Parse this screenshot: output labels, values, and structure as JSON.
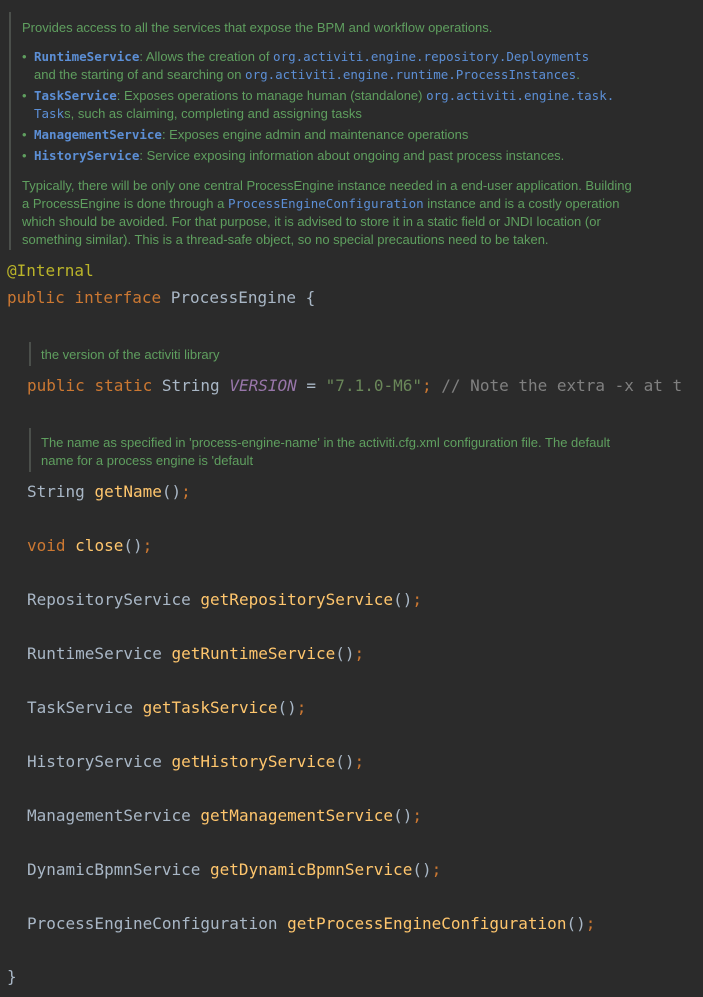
{
  "doc1": {
    "intro": "Provides access to all the services that expose the BPM and workflow operations.",
    "b1_name": "RuntimeService",
    "b1_text": ": Allows the creation of ",
    "b1_ref": "org.activiti.engine.repository.Deployments",
    "b1_cont": "and the starting of and searching on ",
    "b1_ref2": "org.activiti.engine.runtime.ProcessInstances",
    "b1_end": ".",
    "b2_name": "TaskService",
    "b2_text": ": Exposes operations to manage human (standalone) ",
    "b2_ref": "org.activiti.engine.task.",
    "b2_ref_b": "Task",
    "b2_cont": "s, such as claiming, completing and assigning tasks",
    "b3_name": "ManagementService",
    "b3_text": ": Exposes engine admin and maintenance operations",
    "b4_name": "HistoryService",
    "b4_text": ": Service exposing information about ongoing and past process instances.",
    "p1": "Typically, there will be only one central ProcessEngine instance needed in a end-user application. Building",
    "p2a": "a ProcessEngine is done through a ",
    "p2ref": "ProcessEngineConfiguration",
    "p2b": " instance and is a costly operation",
    "p3": "which should be avoided. For that purpose, it is advised to store it in a static field or JNDI location (or",
    "p4": "something similar). This is a thread-safe object, so no special precautions need to be taken."
  },
  "code": {
    "annotation": "@Internal",
    "kw_public": "public",
    "kw_interface": "interface",
    "iface_name": "ProcessEngine",
    "open_brace": "{",
    "doc_version": "the version of the activiti library",
    "kw_static": "static",
    "type_string": "String",
    "const_name": "VERSION",
    "eq": "=",
    "version_value": "\"7.1.0-M6\"",
    "version_comment": "// Note the extra -x at t",
    "doc_name_1": "The name as specified in 'process-engine-name' in the activiti.cfg.xml configuration file. The default",
    "doc_name_2": "name for a process engine is 'default",
    "m_getName": "getName",
    "kw_void": "void",
    "m_close": "close",
    "t_repo": "RepositoryService",
    "m_repo": "getRepositoryService",
    "t_runtime": "RuntimeService",
    "m_runtime": "getRuntimeService",
    "t_task": "TaskService",
    "m_task": "getTaskService",
    "t_history": "HistoryService",
    "m_history": "getHistoryService",
    "t_mgmt": "ManagementService",
    "m_mgmt": "getManagementService",
    "t_dyn": "DynamicBpmnService",
    "m_dyn": "getDynamicBpmnService",
    "t_cfg": "ProcessEngineConfiguration",
    "m_cfg": "getProcessEngineConfiguration",
    "parens": "()",
    "semi": ";",
    "close_brace": "}"
  },
  "colors": {
    "background": "#2b2b2b",
    "doc_text": "#5f9f5f",
    "doc_link": "#5c8fd6",
    "keyword": "#cc7832",
    "method": "#ffc66d",
    "string": "#6a8759",
    "annotation": "#bbb529",
    "constant": "#9876aa"
  }
}
